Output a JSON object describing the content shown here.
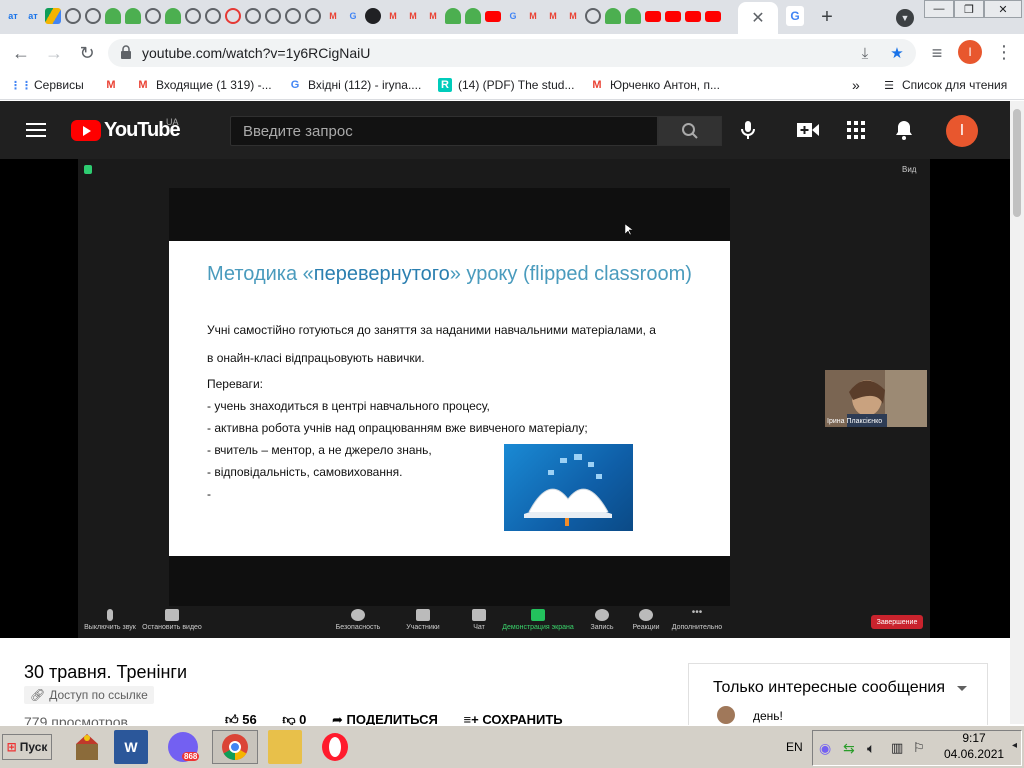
{
  "browser": {
    "url": "youtube.com/watch?v=1y6RCigNaiU",
    "tabs": [
      {
        "icon": "ат-icon",
        "text": "ат"
      },
      {
        "icon": "ат-icon",
        "text": "ат"
      },
      {
        "icon": "google-drive-icon",
        "text": ""
      },
      {
        "icon": "globe-icon",
        "text": ""
      },
      {
        "icon": "globe-icon",
        "text": ""
      },
      {
        "icon": "tree-icon",
        "text": ""
      },
      {
        "icon": "tree-icon",
        "text": ""
      },
      {
        "icon": "globe-icon",
        "text": ""
      },
      {
        "icon": "tree-icon",
        "text": ""
      },
      {
        "icon": "globe-icon",
        "text": ""
      },
      {
        "icon": "globe-icon",
        "text": ""
      },
      {
        "icon": "warning-icon",
        "text": ""
      },
      {
        "icon": "globe-icon",
        "text": ""
      },
      {
        "icon": "globe-icon",
        "text": ""
      },
      {
        "icon": "globe-icon",
        "text": ""
      },
      {
        "icon": "globe-icon",
        "text": ""
      },
      {
        "icon": "gmail-icon",
        "text": "M"
      },
      {
        "icon": "google-icon",
        "text": "G"
      },
      {
        "icon": "blog-icon",
        "text": ""
      },
      {
        "icon": "gmail-icon",
        "text": "M"
      },
      {
        "icon": "gmail-icon",
        "text": "M"
      },
      {
        "icon": "gmail-icon",
        "text": "M"
      },
      {
        "icon": "tree-icon",
        "text": ""
      },
      {
        "icon": "tree-icon",
        "text": ""
      },
      {
        "icon": "youtube-icon",
        "text": ""
      },
      {
        "icon": "google-icon",
        "text": "G"
      },
      {
        "icon": "gmail-icon",
        "text": "M"
      },
      {
        "icon": "gmail-icon",
        "text": "M"
      },
      {
        "icon": "gmail-icon",
        "text": "M"
      },
      {
        "icon": "globe-icon",
        "text": ""
      },
      {
        "icon": "tree-icon",
        "text": ""
      },
      {
        "icon": "tree-icon",
        "text": ""
      },
      {
        "icon": "youtube-icon",
        "text": ""
      },
      {
        "icon": "youtube-icon",
        "text": ""
      },
      {
        "icon": "youtube-icon",
        "text": ""
      },
      {
        "icon": "youtube-icon",
        "text": ""
      }
    ],
    "active_tab_close": "✕",
    "trailing_tab": {
      "icon": "google-icon",
      "text": "G"
    },
    "new_tab": "+",
    "bookmarks": [
      {
        "label": "Сервисы",
        "icon": "apps-icon"
      },
      {
        "label": "",
        "icon": "gmail-icon"
      },
      {
        "label": "Входящие (1 319) -...",
        "icon": "gmail-icon"
      },
      {
        "label": "Вхідні (112) - iryna....",
        "icon": "google-icon"
      },
      {
        "label": "(14) (PDF) The stud...",
        "icon": "researchgate-icon"
      },
      {
        "label": "Юрченко Антон, п...",
        "icon": "gmail-icon"
      }
    ],
    "bookmarks_more": "»",
    "reading_list": "Список для чтения",
    "profile_letter": "I"
  },
  "youtube": {
    "brand": "YouTube",
    "region": "UA",
    "search_placeholder": "Введите запрос",
    "avatar_letter": "I"
  },
  "video": {
    "view_label": "Вид",
    "slide": {
      "title_pre": "Методика «",
      "title_bold": "перевернутого",
      "title_post": "» уроку (flipped classroom)",
      "lines": [
        "Учні самостійно готуються до заняття за наданими навчальними матеріалами, а",
        "в онайн-класі відпрацьовують навички.",
        "Переваги:",
        "- учень знаходиться в центрі навчального процесу,",
        "- активна робота учнів  над опрацюванням вже вивченого матеріалу;",
        "- вчитель – ментор, а не джерело знань,",
        "- відповідальність, самовиховання.",
        "-"
      ]
    },
    "participant_name": "Ірина Плаксієнко",
    "zoom_controls": [
      {
        "label": "Выключить звук",
        "icon": "mic-icon"
      },
      {
        "label": "Остановить видео",
        "icon": "camera-icon"
      },
      {
        "label": "Безопасность",
        "icon": "shield-icon"
      },
      {
        "label": "Участники",
        "icon": "participants-icon",
        "count": "2"
      },
      {
        "label": "Чат",
        "icon": "chat-icon"
      },
      {
        "label": "Демонстрация экрана",
        "icon": "share-screen-icon"
      },
      {
        "label": "Запись",
        "icon": "record-icon"
      },
      {
        "label": "Реакции",
        "icon": "reactions-icon"
      },
      {
        "label": "Дополнительно",
        "icon": "more-icon"
      }
    ],
    "end_label": "Завершение"
  },
  "details": {
    "title": "30 травня. Тренінги",
    "access": "Доступ по ссылке",
    "views": "779 просмотров",
    "likes": "56",
    "dislikes": "0",
    "share": "ПОДЕЛИТЬСЯ",
    "save": "СОХРАНИТЬ"
  },
  "chat": {
    "filter": "Только интересные сообщения",
    "message": "день!"
  },
  "taskbar": {
    "start": "Пуск",
    "language": "EN",
    "time": "9:17",
    "date": "04.06.2021",
    "viber_badge": "868"
  },
  "colors": {
    "youtube_red": "#ff0000",
    "avatar": "#e8572e",
    "slide_title": "#4a9bbd",
    "zoom_end": "#c9232d"
  }
}
